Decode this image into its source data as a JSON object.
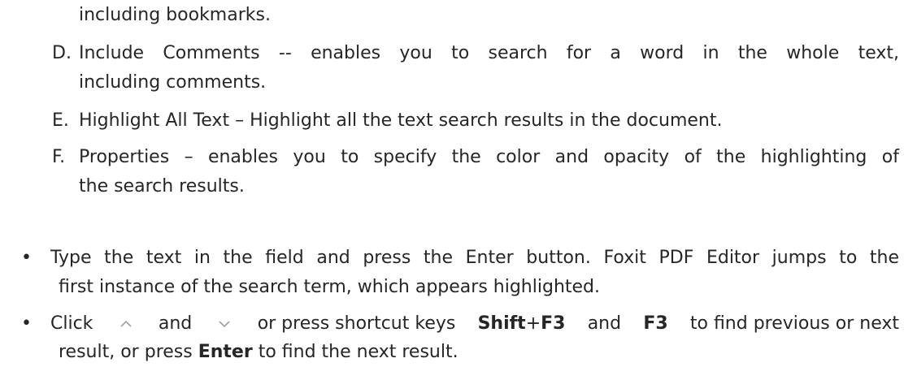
{
  "items": [
    {
      "letter": "",
      "lines": [
        "including bookmarks."
      ]
    },
    {
      "letter": "D.",
      "lines": [
        "Include Comments -- enables you to search for a word in the whole text,",
        "including comments."
      ]
    },
    {
      "letter": "E.",
      "lines": [
        "Highlight All Text – Highlight all the text search results in the document."
      ]
    },
    {
      "letter": "F.",
      "lines": [
        "Properties – enables you to specify the color and opacity of the highlighting of",
        "the search results."
      ]
    }
  ],
  "bullets": [
    {
      "symbol": "•",
      "line1": "Type the text in the field and press the Enter button. Foxit PDF Editor jumps to the",
      "line2": "first instance of the search term, which appears highlighted."
    },
    {
      "symbol": "•",
      "line1_parts": {
        "click": "Click",
        "and": "and",
        "or_press": "or press shortcut keys",
        "shift": "Shift",
        "plus": "+",
        "f3a": "F3",
        "and2": "and",
        "f3b": "F3",
        "tail": "to find previous or next"
      },
      "line2_parts": {
        "head": "result, or press",
        "enter": "Enter",
        "tail": "to find the next result."
      },
      "icons": [
        "chevron-up-icon",
        "chevron-down-icon"
      ]
    }
  ]
}
